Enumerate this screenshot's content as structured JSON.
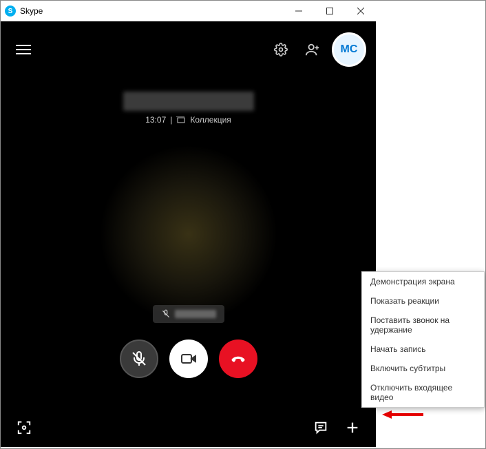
{
  "titlebar": {
    "appName": "Skype",
    "iconLetter": "S"
  },
  "topbar": {
    "avatarInitials": "MC"
  },
  "centerInfo": {
    "time": "13:07",
    "separator": "|",
    "collectionLabel": "Коллекция"
  },
  "contextMenu": {
    "items": [
      {
        "label": "Демонстрация экрана"
      },
      {
        "label": "Показать реакции"
      },
      {
        "label": "Поставить звонок на удержание"
      },
      {
        "label": "Начать запись"
      },
      {
        "label": "Включить субтитры"
      },
      {
        "label": "Отключить входящее видео"
      }
    ]
  }
}
